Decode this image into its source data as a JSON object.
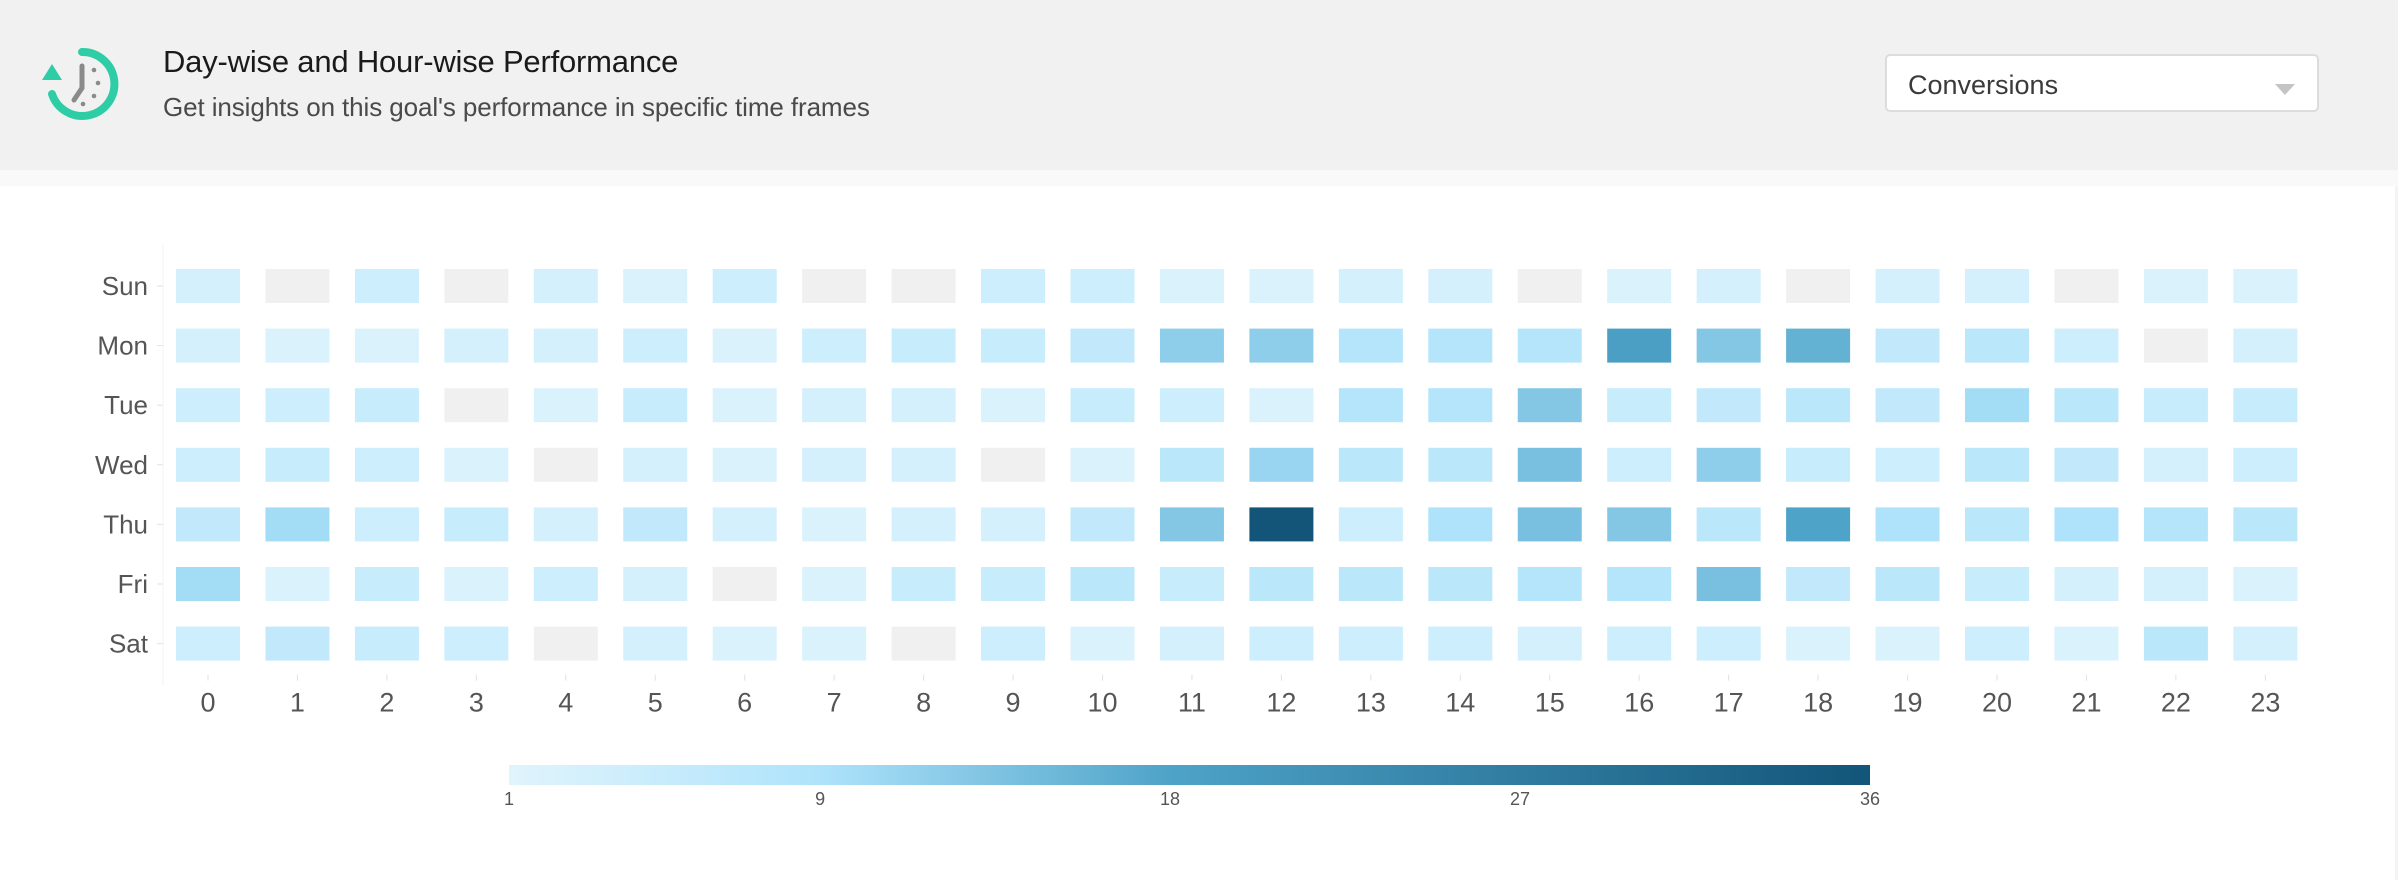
{
  "header": {
    "icon": "clock-history-icon",
    "title": "Day-wise and Hour-wise Performance",
    "subtitle": "Get insights on this goal's performance in specific time frames",
    "metric_dropdown": {
      "selected": "Conversions",
      "icon": "caret-down-icon"
    }
  },
  "colors": {
    "brand_icon": "#2ecda6",
    "icon_clock": "#8a8a8a",
    "empty_cell": "#f0f0f0",
    "scale": [
      "#e0f4fc",
      "#aee3fb",
      "#4ea3c8",
      "#125579"
    ]
  },
  "chart_data": {
    "type": "heatmap",
    "title": "",
    "xlabel": "",
    "ylabel": "",
    "x": [
      "0",
      "1",
      "2",
      "3",
      "4",
      "5",
      "6",
      "7",
      "8",
      "9",
      "10",
      "11",
      "12",
      "13",
      "14",
      "15",
      "16",
      "17",
      "18",
      "19",
      "20",
      "21",
      "22",
      "23"
    ],
    "y": [
      "Sun",
      "Mon",
      "Tue",
      "Wed",
      "Thu",
      "Fri",
      "Sat"
    ],
    "values": [
      [
        3,
        0,
        4,
        0,
        3,
        2,
        4,
        0,
        0,
        4,
        4,
        2,
        2,
        3,
        3,
        0,
        2,
        3,
        0,
        3,
        3,
        0,
        2,
        2
      ],
      [
        3,
        2,
        2,
        3,
        3,
        4,
        2,
        4,
        5,
        5,
        6,
        12,
        12,
        8,
        8,
        8,
        19,
        13,
        16,
        6,
        7,
        4,
        0,
        3
      ],
      [
        4,
        4,
        5,
        0,
        2,
        5,
        2,
        3,
        3,
        2,
        5,
        4,
        2,
        8,
        8,
        13,
        5,
        6,
        7,
        6,
        10,
        7,
        5,
        5
      ],
      [
        4,
        5,
        4,
        2,
        0,
        3,
        2,
        3,
        3,
        0,
        2,
        7,
        11,
        7,
        7,
        14,
        4,
        12,
        5,
        4,
        7,
        6,
        3,
        4
      ],
      [
        6,
        10,
        4,
        5,
        3,
        6,
        3,
        2,
        3,
        3,
        6,
        13,
        36,
        4,
        9,
        14,
        13,
        7,
        18,
        9,
        7,
        9,
        8,
        7
      ],
      [
        10,
        2,
        5,
        2,
        4,
        3,
        0,
        2,
        5,
        5,
        7,
        5,
        7,
        7,
        7,
        8,
        8,
        14,
        6,
        7,
        5,
        3,
        3,
        2
      ],
      [
        4,
        6,
        5,
        4,
        0,
        3,
        2,
        2,
        0,
        4,
        2,
        3,
        4,
        4,
        4,
        3,
        4,
        4,
        2,
        2,
        4,
        2,
        7,
        3
      ]
    ],
    "zero_means": "no data (gray)",
    "color_scale": {
      "min": 1,
      "max": 36,
      "stops": [
        1,
        9,
        18,
        36
      ],
      "tick_labels": [
        "1",
        "9",
        "18",
        "27",
        "36"
      ],
      "placement": "bottom-center"
    },
    "grid": false
  }
}
